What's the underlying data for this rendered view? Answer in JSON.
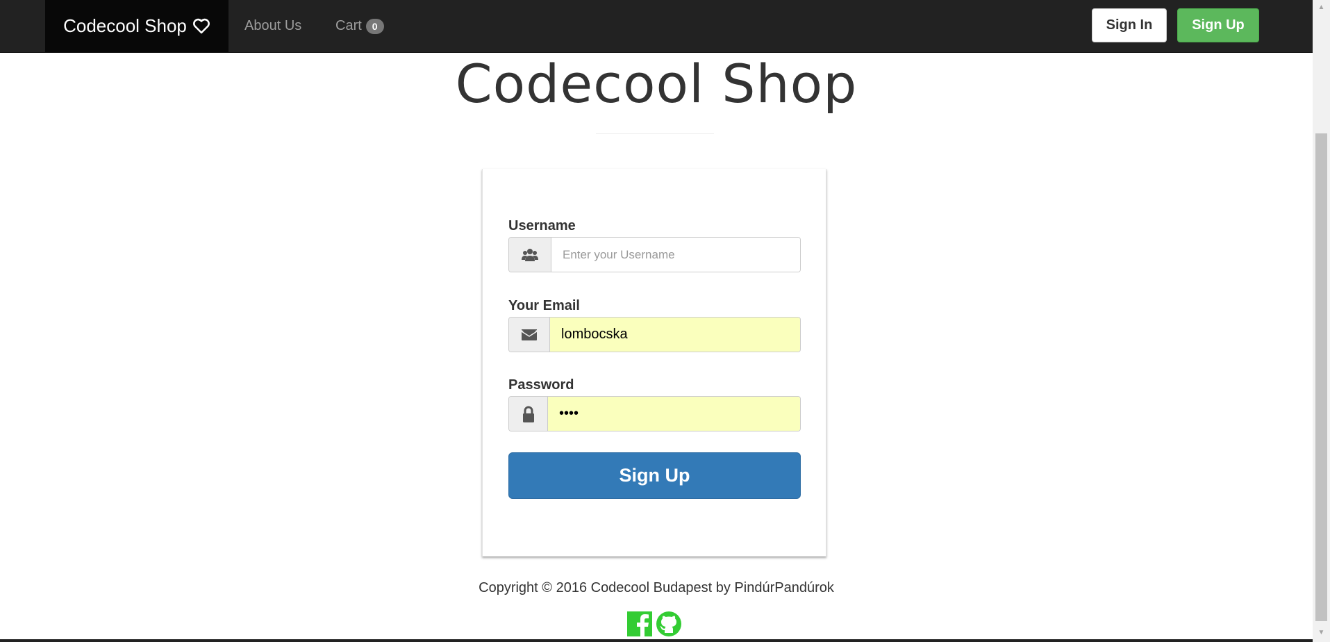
{
  "navbar": {
    "brand": "Codecool Shop",
    "links": [
      {
        "label": "About Us"
      },
      {
        "label": "Cart",
        "badge": "0"
      }
    ],
    "sign_in_label": "Sign In",
    "sign_up_label": "Sign Up"
  },
  "header": {
    "title": "Codecool Shop"
  },
  "form": {
    "username_label": "Username",
    "username_placeholder": "Enter your Username",
    "username_value": "",
    "email_label": "Your Email",
    "email_value": "lombocska",
    "password_label": "Password",
    "password_value": "••••",
    "submit_label": "Sign Up"
  },
  "footer": {
    "copyright": "Copyright © 2016 Codecool Budapest by PindúrPandúrok"
  },
  "colors": {
    "navbar_bg": "#222222",
    "brand_bg": "#080808",
    "signup_green": "#5cb85c",
    "primary_blue": "#337ab7",
    "autofill_yellow": "#faffbd",
    "social_green": "#3c3"
  },
  "icons": {
    "brand": "heart-icon",
    "username": "users-icon",
    "email": "envelope-icon",
    "password": "lock-icon",
    "footer": [
      "facebook-icon",
      "github-icon"
    ]
  }
}
